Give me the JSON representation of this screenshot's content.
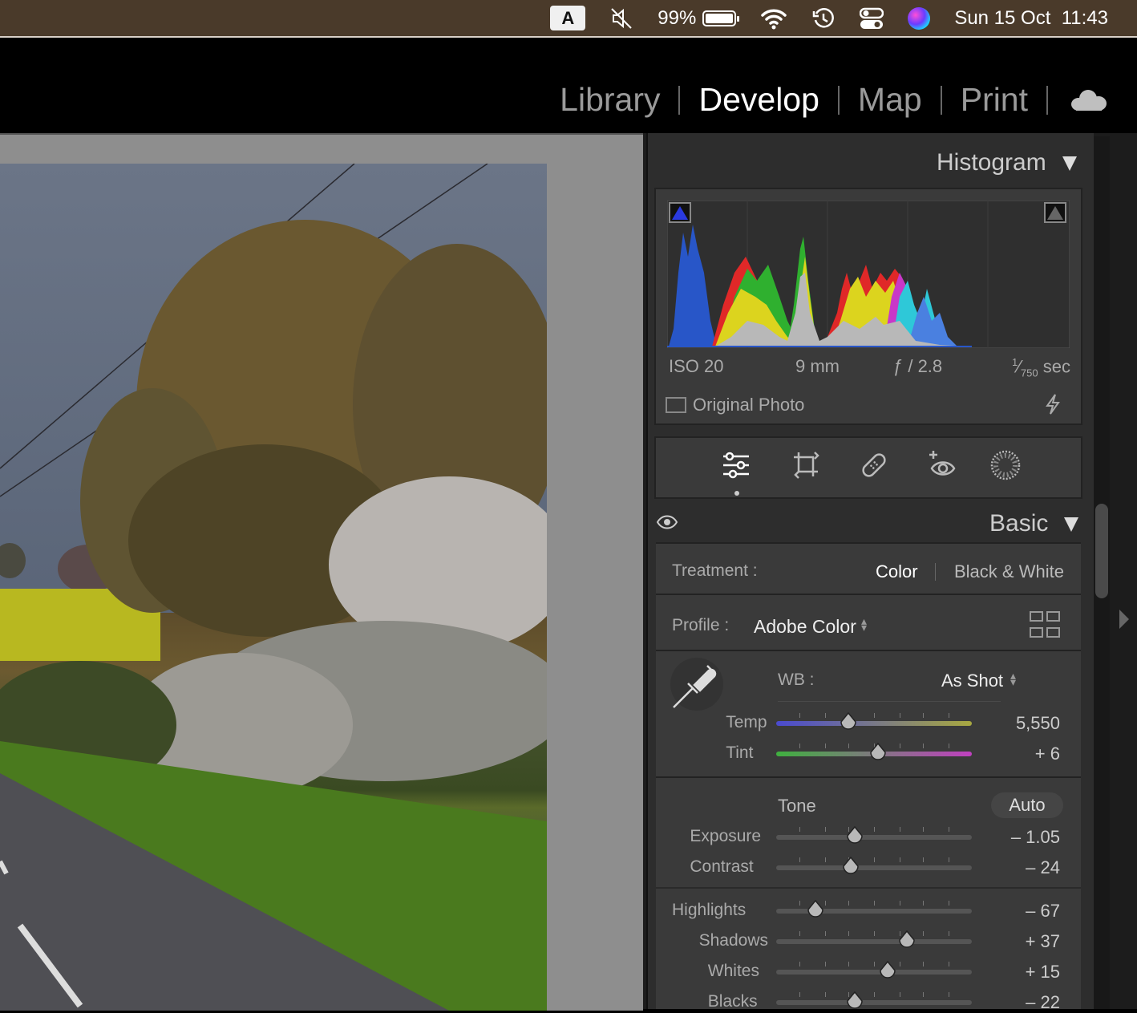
{
  "menubar": {
    "input_badge": "A",
    "battery": "99%",
    "battery_level": 0.99,
    "datetime": "Sun 15 Oct  11:43"
  },
  "modules": {
    "items": [
      "Library",
      "Develop",
      "Map",
      "Print"
    ],
    "active": "Develop"
  },
  "histogram": {
    "title": "Histogram",
    "iso": "ISO 20",
    "focal": "9 mm",
    "aperture": "ƒ / 2.8",
    "shutter_num": "1",
    "shutter_den": "750",
    "shutter_unit": "sec",
    "original_photo": "Original Photo"
  },
  "basic": {
    "title": "Basic",
    "treatment_label": "Treatment :",
    "treatment_color": "Color",
    "treatment_bw": "Black & White",
    "profile_label": "Profile :",
    "profile_value": "Adobe Color",
    "wb_label": "WB :",
    "wb_value": "As Shot",
    "tone_label": "Tone",
    "auto_label": "Auto",
    "sliders": [
      {
        "label": "Temp",
        "value": "5,550",
        "pos": 0.37
      },
      {
        "label": "Tint",
        "value": "+ 6",
        "pos": 0.52
      },
      {
        "label": "Exposure",
        "value": "– 1.05",
        "pos": 0.4
      },
      {
        "label": "Contrast",
        "value": "– 24",
        "pos": 0.38
      },
      {
        "label": "Highlights",
        "value": "– 67",
        "pos": 0.2
      },
      {
        "label": "Shadows",
        "value": "+ 37",
        "pos": 0.67
      },
      {
        "label": "Whites",
        "value": "+ 15",
        "pos": 0.57
      },
      {
        "label": "Blacks",
        "value": "– 22",
        "pos": 0.4
      }
    ]
  },
  "colors": {
    "menubar": "#4a3a2a",
    "panel": "#2d2d2d",
    "canvas": "#8e8e8e"
  }
}
